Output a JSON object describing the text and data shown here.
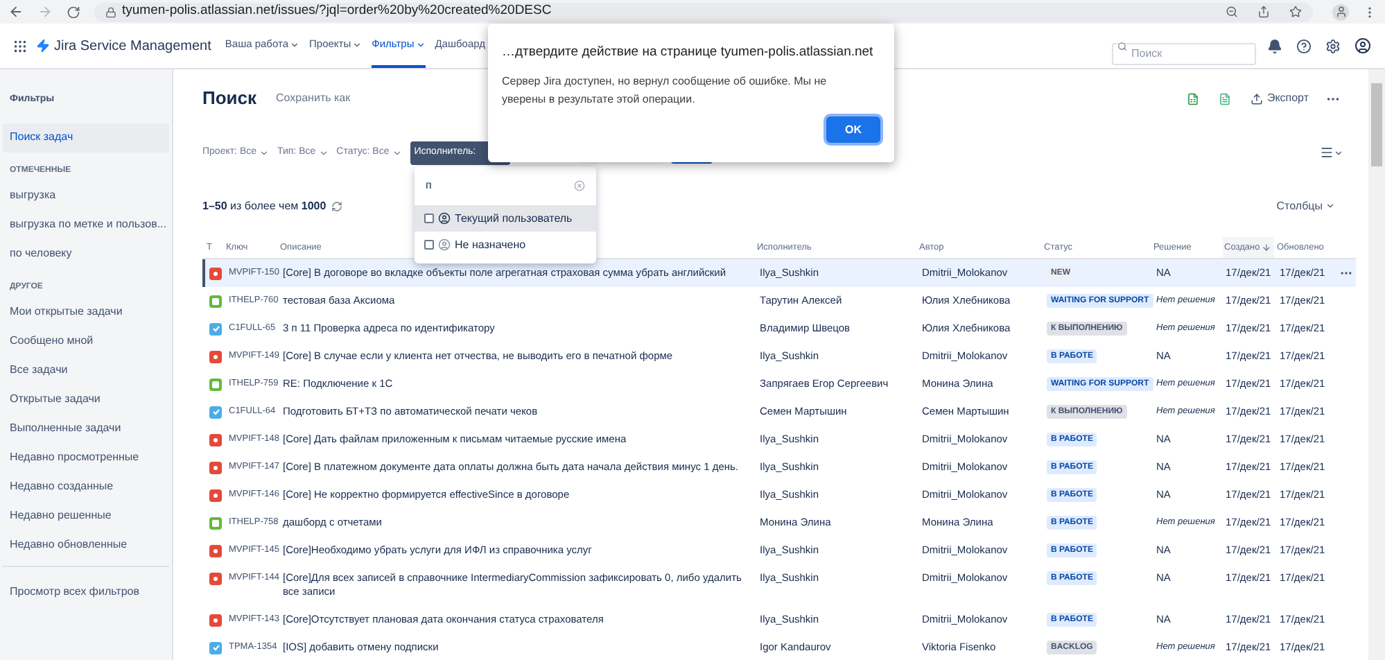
{
  "browser": {
    "url": "tyumen-polis.atlassian.net/issues/?jql=order%20by%20created%20DESC"
  },
  "header": {
    "product": "Jira Service Management",
    "nav": [
      {
        "label": "Ваша работа",
        "selected": false
      },
      {
        "label": "Проекты",
        "selected": false
      },
      {
        "label": "Фильтры",
        "selected": true
      },
      {
        "label": "Дашбоард",
        "selected": false
      }
    ],
    "search": {
      "placeholder": "Поиск"
    }
  },
  "sidebar": {
    "title": "Фильтры",
    "sections": [
      {
        "items": [
          {
            "label": "Поиск задач",
            "selected": true
          }
        ]
      },
      {
        "heading": "ОТМЕЧЕННЫЕ",
        "items": [
          {
            "label": "выгрузка",
            "selected": false
          },
          {
            "label": "выгрузка по метке и пользов...",
            "selected": false
          },
          {
            "label": "по человеку",
            "selected": false
          }
        ]
      },
      {
        "heading": "ДРУГОЕ",
        "items": [
          {
            "label": "Мои открытые задачи",
            "selected": false
          },
          {
            "label": "Сообщено мной",
            "selected": false
          },
          {
            "label": "Все задачи",
            "selected": false
          },
          {
            "label": "Открытые задачи",
            "selected": false
          },
          {
            "label": "Выполненные задачи",
            "selected": false
          },
          {
            "label": "Недавно просмотренные",
            "selected": false
          },
          {
            "label": "Недавно созданные",
            "selected": false
          },
          {
            "label": "Недавно решенные",
            "selected": false
          },
          {
            "label": "Недавно обновленные",
            "selected": false
          }
        ]
      }
    ],
    "footer": "Просмотр всех фильтров"
  },
  "page": {
    "title": "Поиск",
    "save_as": "Сохранить как",
    "export": "Экспорт"
  },
  "filters": [
    {
      "label": "Проект: Все",
      "active": false
    },
    {
      "label": "Тип: Все",
      "active": false
    },
    {
      "label": "Статус: Все",
      "active": false
    },
    {
      "label": "Исполнитель:",
      "active": true
    }
  ],
  "assignee_dropdown": {
    "value": "п",
    "options": [
      {
        "label": "Текущий пользователь",
        "checked": false,
        "highlighted": true
      },
      {
        "label": "Не назначено",
        "checked": false,
        "highlighted": false
      }
    ]
  },
  "count": "**1–50** из более чем **1000**",
  "columns_button": "Столбцы",
  "table": {
    "columns": [
      "Т",
      "Ключ",
      "Описание",
      "Исполнитель",
      "Автор",
      "Статус",
      "Решение",
      "Создано",
      "Обновлено"
    ],
    "rows": [
      {
        "kind": "bug",
        "key": "MVPIFT-150",
        "summary": "[Core] В договоре во вкладке объекты поле агрегатная страховая сумма убрать английский",
        "assignee": "Ilya_Sushkin",
        "reporter": "Dmitrii_Molokanov",
        "status": {
          "label": "NEW",
          "kind": "new"
        },
        "resolution": "NA",
        "unresolved": false,
        "created": "17/дек/21",
        "updated": "17/дек/21",
        "selected": true
      },
      {
        "kind": "story",
        "key": "ITHELP-760",
        "summary": "тестовая база Аксиома",
        "assignee": "Тарутин Алексей",
        "reporter": "Юлия Хлебникова",
        "status": {
          "label": "WAITING FOR SUPPORT",
          "kind": "progress"
        },
        "resolution": "Нет решения",
        "unresolved": true,
        "created": "17/дек/21",
        "updated": "17/дек/21",
        "selected": false
      },
      {
        "kind": "task",
        "key": "C1FULL-65",
        "summary": "3 п 11 Проверка адреса по идентификатору",
        "assignee": "Владимир Швецов",
        "reporter": "Юлия Хлебникова",
        "status": {
          "label": "К ВЫПОЛНЕНИЮ",
          "kind": "todo"
        },
        "resolution": "Нет решения",
        "unresolved": true,
        "created": "17/дек/21",
        "updated": "17/дек/21",
        "selected": false
      },
      {
        "kind": "bug",
        "key": "MVPIFT-149",
        "summary": "[Core] В случае если у клиента нет отчества, не выводить его в печатной форме",
        "assignee": "Ilya_Sushkin",
        "reporter": "Dmitrii_Molokanov",
        "status": {
          "label": "В РАБОТЕ",
          "kind": "progress"
        },
        "resolution": "NA",
        "unresolved": false,
        "created": "17/дек/21",
        "updated": "17/дек/21",
        "selected": false
      },
      {
        "kind": "story",
        "key": "ITHELP-759",
        "summary": "RE: Подключение к 1С",
        "assignee": "Запрягаев Егор Сергеевич",
        "reporter": "Монина Элина",
        "status": {
          "label": "WAITING FOR SUPPORT",
          "kind": "progress"
        },
        "resolution": "Нет решения",
        "unresolved": true,
        "created": "17/дек/21",
        "updated": "17/дек/21",
        "selected": false
      },
      {
        "kind": "task",
        "key": "C1FULL-64",
        "summary": "Подготовить БТ+ТЗ по автоматической печати чеков",
        "assignee": "Семен Мартышин",
        "reporter": "Семен Мартышин",
        "status": {
          "label": "К ВЫПОЛНЕНИЮ",
          "kind": "todo"
        },
        "resolution": "Нет решения",
        "unresolved": true,
        "created": "17/дек/21",
        "updated": "17/дек/21",
        "selected": false
      },
      {
        "kind": "bug",
        "key": "MVPIFT-148",
        "summary": "[Core] Дать файлам приложенным к письмам читаемые русские имена",
        "assignee": "Ilya_Sushkin",
        "reporter": "Dmitrii_Molokanov",
        "status": {
          "label": "В РАБОТЕ",
          "kind": "progress"
        },
        "resolution": "NA",
        "unresolved": false,
        "created": "17/дек/21",
        "updated": "17/дек/21",
        "selected": false
      },
      {
        "kind": "bug",
        "key": "MVPIFT-147",
        "summary": "[Core] В платежном документе дата оплаты должна быть дата начала действия минус 1 день.",
        "assignee": "Ilya_Sushkin",
        "reporter": "Dmitrii_Molokanov",
        "status": {
          "label": "В РАБОТЕ",
          "kind": "progress"
        },
        "resolution": "NA",
        "unresolved": false,
        "created": "17/дек/21",
        "updated": "17/дек/21",
        "selected": false
      },
      {
        "kind": "bug",
        "key": "MVPIFT-146",
        "summary": "[Core] Не корректно формируется effectiveSince в договоре",
        "assignee": "Ilya_Sushkin",
        "reporter": "Dmitrii_Molokanov",
        "status": {
          "label": "В РАБОТЕ",
          "kind": "progress"
        },
        "resolution": "NA",
        "unresolved": false,
        "created": "17/дек/21",
        "updated": "17/дек/21",
        "selected": false
      },
      {
        "kind": "story",
        "key": "ITHELP-758",
        "summary": "дашборд с отчетами",
        "assignee": "Монина Элина",
        "reporter": "Монина Элина",
        "status": {
          "label": "В РАБОТЕ",
          "kind": "progress"
        },
        "resolution": "Нет решения",
        "unresolved": true,
        "created": "17/дек/21",
        "updated": "17/дек/21",
        "selected": false
      },
      {
        "kind": "bug",
        "key": "MVPIFT-145",
        "summary": "[Core]Необходимо убрать услуги для ИФЛ из справочника услуг",
        "assignee": "Ilya_Sushkin",
        "reporter": "Dmitrii_Molokanov",
        "status": {
          "label": "В РАБОТЕ",
          "kind": "progress"
        },
        "resolution": "NA",
        "unresolved": false,
        "created": "17/дек/21",
        "updated": "17/дек/21",
        "selected": false
      },
      {
        "kind": "bug",
        "key": "MVPIFT-144",
        "summary": "[Core]Для всех записей в справочнике IntermediaryCommission зафиксировать 0, либо удалить все записи",
        "assignee": "Ilya_Sushkin",
        "reporter": "Dmitrii_Molokanov",
        "status": {
          "label": "В РАБОТЕ",
          "kind": "progress"
        },
        "resolution": "NA",
        "unresolved": false,
        "created": "17/дек/21",
        "updated": "17/дек/21",
        "selected": false
      },
      {
        "kind": "bug",
        "key": "MVPIFT-143",
        "summary": "[Core]Отсутствует плановая дата окончания статуса страхователя",
        "assignee": "Ilya_Sushkin",
        "reporter": "Dmitrii_Molokanov",
        "status": {
          "label": "В РАБОТЕ",
          "kind": "progress"
        },
        "resolution": "NA",
        "unresolved": false,
        "created": "17/дек/21",
        "updated": "17/дек/21",
        "selected": false
      },
      {
        "kind": "task",
        "key": "TPMA-1354",
        "summary": "[IOS] добавить отмену подписки",
        "assignee": "Igor Kandaurov",
        "reporter": "Viktoria Fisenko",
        "status": {
          "label": "BACKLOG",
          "kind": "todo"
        },
        "resolution": "Нет решения",
        "unresolved": true,
        "created": "17/дек/21",
        "updated": "17/дек/21",
        "selected": false
      }
    ]
  },
  "dialog": {
    "title": "…дтвердите действие на странице tyumen-polis.atlassian.net",
    "message": "Сервер Jira доступен, но вернул сообщение об ошибке. Мы не уверены в результате этой операции.",
    "button": "OK"
  }
}
